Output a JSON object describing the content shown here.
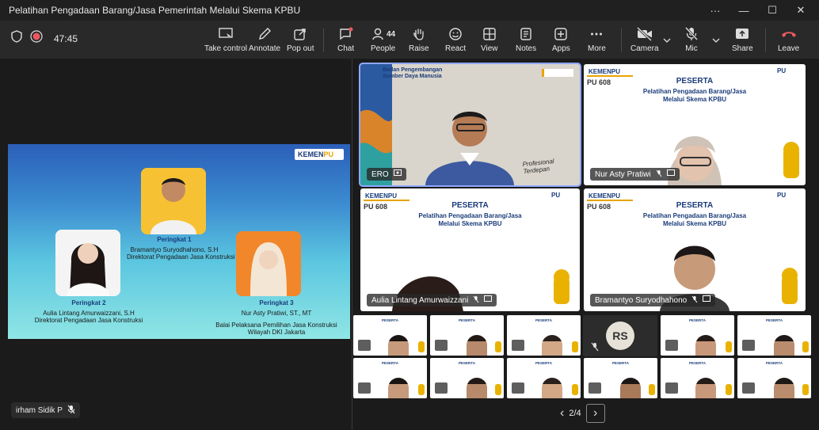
{
  "window": {
    "title": "Pelatihan Pengadaan Barang/Jasa Pemerintah Melalui Skema KPBU",
    "more_label": "···",
    "minimize_label": "—",
    "maximize_label": "☐",
    "close_label": "✕"
  },
  "toolbar": {
    "timer": "47:45",
    "take_control": "Take control",
    "annotate": "Annotate",
    "pop_out": "Pop out",
    "chat": "Chat",
    "people": "People",
    "people_count": "44",
    "raise": "Raise",
    "react": "React",
    "view": "View",
    "notes": "Notes",
    "apps": "Apps",
    "more": "More",
    "camera": "Camera",
    "mic": "Mic",
    "share": "Share",
    "leave": "Leave"
  },
  "shared_slide": {
    "logo_text": "KEMEN",
    "logo_accent": "PU",
    "rank1": {
      "title": "Peringkat 1",
      "name": "Bramantyo Suryodhahono, S.H",
      "unit": "Direktorat Pengadaan Jasa Konstruksi"
    },
    "rank2": {
      "title": "Peringkat 2",
      "name": "Aulia Lintang Amurwaizzani, S.H",
      "unit": "Direktorat Pengadaan Jasa Konstruksi"
    },
    "rank3": {
      "title": "Peringkat 3",
      "name": "Nur Asty Pratiwi, ST., MT",
      "unit": "Balai Pelaksana Pemilihan Jasa Konstruksi",
      "unit2": "Wilayah DKI Jakarta"
    }
  },
  "self_view": {
    "name": "irham Sidik P"
  },
  "tiles": {
    "speaker": {
      "name": "ERO",
      "header1": "Badan Pengembangan",
      "header2": "Sumber Daya Manusia",
      "signature": "Profesional Terdepan"
    },
    "peserta_title": "PESERTA",
    "peserta_line1": "Pelatihan Pengadaan Barang/Jasa",
    "peserta_line2": "Melalui Skema KPBU",
    "kpu_logo": "KEMENPU",
    "pu608": "PU 608",
    "pu_mark": "PU",
    "tile2_name": "Nur Asty Pratiwi",
    "tile3_name": "Aulia Lintang Amurwaizzani",
    "tile4_name": "Bramantyo Suryodhahono"
  },
  "thumbs_title": "PESERTA",
  "rs_initials": "RS",
  "pager": {
    "label": "2/4",
    "prev": "‹",
    "next": "›"
  },
  "colors": {
    "accent": "#8fa8ff",
    "leave": "#e8595e",
    "brand": "#163a7a",
    "gold": "#e9a400"
  }
}
